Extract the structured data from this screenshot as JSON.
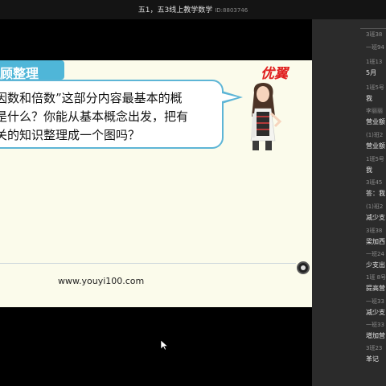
{
  "window": {
    "title": "五1，五3线上教学数学",
    "room_id": "ID:8803746"
  },
  "slide": {
    "tag": "顾整理",
    "brand": "优翼",
    "question_lines": [
      "因数和倍数”这部分内容最基本的概",
      "是什么？你能从基本概念出发，把有",
      "关的知识整理成一个图吗？"
    ],
    "url": "www.youyi100.com"
  },
  "chat": [
    {
      "name": "3班38",
      "text": ""
    },
    {
      "name": "一班94",
      "text": ""
    },
    {
      "name": "1班13",
      "text": "5月"
    },
    {
      "name": "1班5号",
      "text": "我"
    },
    {
      "name": "李丽丽",
      "text": "营业额"
    },
    {
      "name": "(1)班2",
      "text": "营业额"
    },
    {
      "name": "1班5号",
      "text": "我"
    },
    {
      "name": "3班45",
      "text": "答：我"
    },
    {
      "name": "(1)班2",
      "text": "减少支"
    },
    {
      "name": "3班38",
      "text": "梁加西"
    },
    {
      "name": "一班24",
      "text": "少支出"
    },
    {
      "name": "1班 8号",
      "text": "提高营"
    },
    {
      "name": "一班33",
      "text": "减少支"
    },
    {
      "name": "一班33",
      "text": "增加营"
    },
    {
      "name": "3班23",
      "text": "革记"
    }
  ]
}
